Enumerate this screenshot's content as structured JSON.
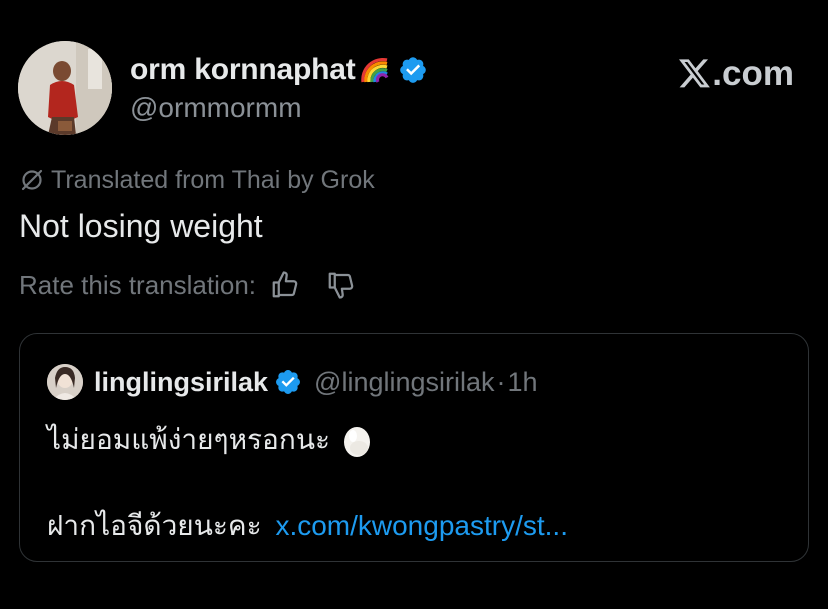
{
  "author": {
    "display_name": "orm kornnaphat",
    "display_name_emoji": "🌈",
    "handle": "@ormmormm",
    "verified_icon": "verified-badge-icon"
  },
  "brand": {
    "logo": "𝕏",
    "text": ".com"
  },
  "translation": {
    "note": "Translated from Thai by Grok",
    "text": "Not losing weight",
    "rate_label": "Rate this translation:"
  },
  "quoted": {
    "display_name": "linglingsirilak",
    "handle": "@linglingsirilak",
    "separator": "·",
    "time": "1h",
    "line1": "ไม่ยอมแพ้ง่ายๆหรอกนะ",
    "line2_prefix": "ฝากไอจีด้วยนะคะ",
    "line2_link": "x.com/kwongpastry/st..."
  },
  "colors": {
    "background": "#000000",
    "primary_text": "#e7e9ea",
    "secondary_text": "#71767b",
    "link": "#1d9bf0",
    "verified": "#1d9bf0",
    "border": "#2f3336"
  }
}
